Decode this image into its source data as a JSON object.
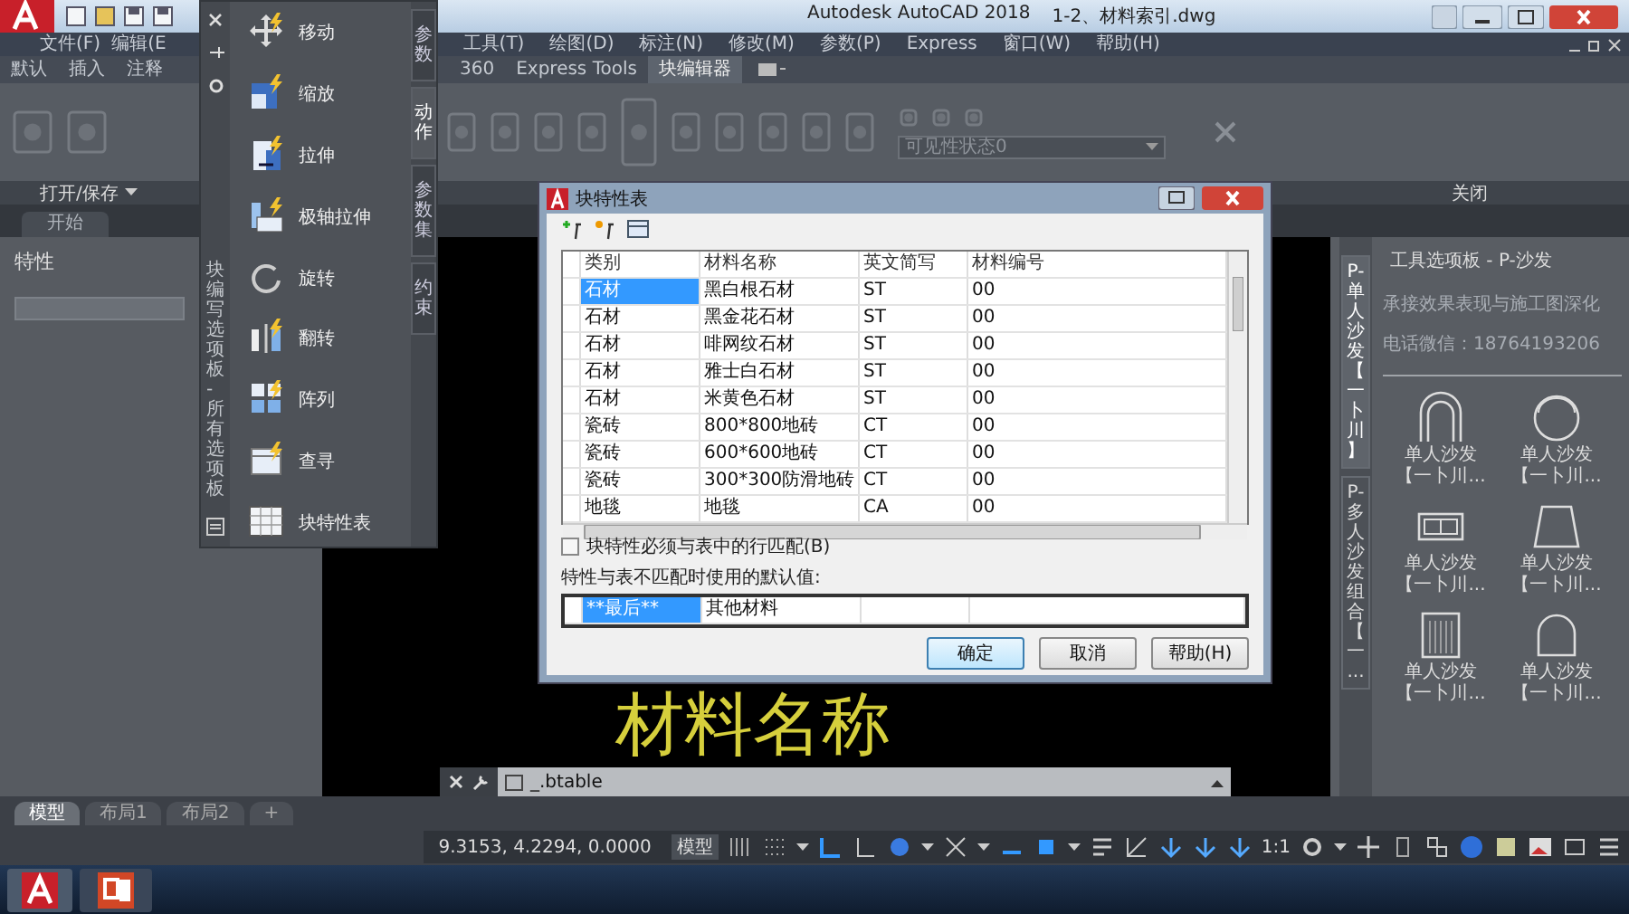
{
  "title_bar": {
    "app": "Autodesk AutoCAD 2018",
    "file": "1-2、材料索引.dwg"
  },
  "menu_bar": {
    "left": [
      "文件(F)",
      "编辑(E"
    ],
    "right": [
      "工具(T)",
      "绘图(D)",
      "标注(N)",
      "修改(M)",
      "参数(P)",
      "Express",
      "窗口(W)",
      "帮助(H)"
    ]
  },
  "ribbon_tabs": {
    "left": [
      {
        "label": "默认",
        "selected": false
      },
      {
        "label": "插入",
        "selected": false
      },
      {
        "label": "注释",
        "selected": false
      }
    ],
    "right": [
      {
        "label": "360",
        "selected": false
      },
      {
        "label": "Express Tools",
        "selected": false
      },
      {
        "label": "块编辑器",
        "selected": true
      }
    ]
  },
  "ribbon": {
    "open_save_label": "打开/保存",
    "visibility_dropdown": "可见性状态0",
    "close_label": "关闭"
  },
  "file_tabs": [
    {
      "label": "开始",
      "selected": false
    }
  ],
  "properties_panel": {
    "title": "特性"
  },
  "drawing": {
    "text": "材料名称"
  },
  "command_line": {
    "value": "_.btable"
  },
  "block_palette": {
    "title": "块编写选项板 - 所有选项板",
    "items": [
      {
        "label": "移动",
        "kind": "move"
      },
      {
        "label": "缩放",
        "kind": "scale"
      },
      {
        "label": "拉伸",
        "kind": "stretch"
      },
      {
        "label": "极轴拉伸",
        "kind": "polar"
      },
      {
        "label": "旋转",
        "kind": "rotate"
      },
      {
        "label": "翻转",
        "kind": "flip"
      },
      {
        "label": "阵列",
        "kind": "array"
      },
      {
        "label": "查寻",
        "kind": "lookup"
      },
      {
        "label": "块特性表",
        "kind": "table"
      }
    ],
    "tabs": [
      {
        "label": "参数",
        "selected": false
      },
      {
        "label": "动作",
        "selected": true
      },
      {
        "label": "参数集",
        "selected": false
      },
      {
        "label": "约束",
        "selected": false
      }
    ]
  },
  "dialog": {
    "title": "块特性表",
    "columns": [
      "类别",
      "材料名称",
      "英文简写",
      "材料编号"
    ],
    "rows": [
      {
        "cells": [
          "石材",
          "黑白根石材",
          "ST",
          "00"
        ],
        "selected": true
      },
      {
        "cells": [
          "石材",
          "黑金花石材",
          "ST",
          "00"
        ],
        "selected": false
      },
      {
        "cells": [
          "石材",
          "啡网纹石材",
          "ST",
          "00"
        ],
        "selected": false
      },
      {
        "cells": [
          "石材",
          "雅士白石材",
          "ST",
          "00"
        ],
        "selected": false
      },
      {
        "cells": [
          "石材",
          "米黄色石材",
          "ST",
          "00"
        ],
        "selected": false
      },
      {
        "cells": [
          "瓷砖",
          "800*800地砖",
          "CT",
          "00"
        ],
        "selected": false
      },
      {
        "cells": [
          "瓷砖",
          "600*600地砖",
          "CT",
          "00"
        ],
        "selected": false
      },
      {
        "cells": [
          "瓷砖",
          "300*300防滑地砖",
          "CT",
          "00"
        ],
        "selected": false
      },
      {
        "cells": [
          "地毯",
          "地毯",
          "CA",
          "00"
        ],
        "selected": false
      }
    ],
    "match_checkbox": {
      "label": "块特性必须与表中的行匹配(B)",
      "checked": false
    },
    "default_label": "特性与表不匹配时使用的默认值:",
    "default_row": {
      "cells": [
        "**最后**",
        "其他材料"
      ],
      "selected": true
    },
    "buttons": [
      {
        "label": "确定",
        "default": true
      },
      {
        "label": "取消",
        "default": false
      },
      {
        "label": "帮助(H)",
        "default": false
      }
    ]
  },
  "tool_palette": {
    "title": "工具选项板 - P-沙发",
    "info": [
      "承接效果表现与施工图深化",
      "电话微信：18764193206"
    ],
    "tabs": [
      {
        "label": "P-单人沙发【一卜川】",
        "selected": true
      },
      {
        "label": "P-多人沙发组合【一...",
        "selected": false
      }
    ],
    "items": [
      {
        "name": "单人沙发",
        "note": "【一卜川...",
        "kind": "arch"
      },
      {
        "name": "单人沙发",
        "note": "【一卜川...",
        "kind": "round"
      },
      {
        "name": "单人沙发",
        "note": "【一卜川...",
        "kind": "sofa"
      },
      {
        "name": "单人沙发",
        "note": "【一卜川...",
        "kind": "trapezoid"
      },
      {
        "name": "单人沙发",
        "note": "【一卜川...",
        "kind": "striped"
      },
      {
        "name": "单人沙发",
        "note": "【一卜川...",
        "kind": "tub"
      }
    ]
  },
  "layout_tabs": [
    {
      "label": "模型",
      "selected": true
    },
    {
      "label": "布局1",
      "selected": false
    },
    {
      "label": "布局2",
      "selected": false
    }
  ],
  "add_layout": "+",
  "status_bar": {
    "coordinates": "9.3153, 4.2294, 0.0000",
    "space": "模型",
    "scale": "1:1"
  }
}
